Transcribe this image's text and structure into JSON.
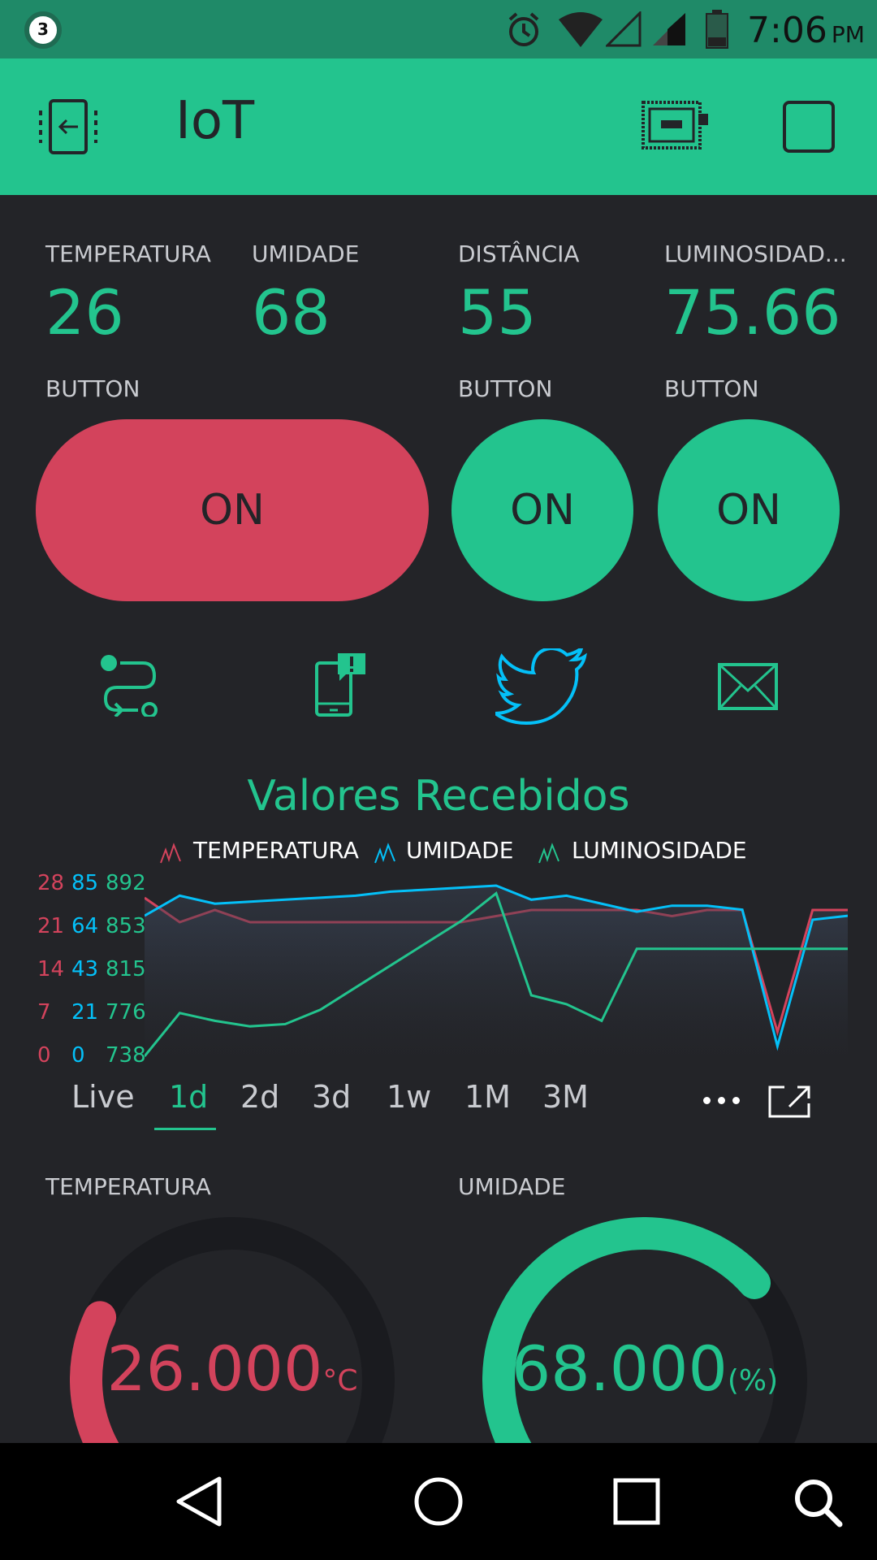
{
  "status": {
    "notification_count": "3",
    "time": "7:06",
    "ampm": "PM"
  },
  "app": {
    "title": "IoT"
  },
  "values": [
    {
      "label": "TEMPERATURA",
      "value": "26"
    },
    {
      "label": "UMIDADE",
      "value": "68"
    },
    {
      "label": "DISTÂNCIA",
      "value": "55"
    },
    {
      "label": "LUMINOSIDAD...",
      "value": "75.66"
    }
  ],
  "buttons": [
    {
      "label": "BUTTON",
      "state": "ON"
    },
    {
      "label": "BUTTON",
      "state": "ON"
    },
    {
      "label": "BUTTON",
      "state": "ON"
    }
  ],
  "colors": {
    "accent": "#23c48e",
    "red": "#d3435c",
    "blue": "#04c0f8",
    "bg": "#232428",
    "status": "#1f8a68"
  },
  "icons": [
    "eventor-icon",
    "notification-phone-icon",
    "twitter-icon",
    "mail-icon"
  ],
  "chart": {
    "title": "Valores Recebidos",
    "legend": [
      "TEMPERATURA",
      "UMIDADE",
      "LUMINOSIDADE"
    ],
    "axis_temp": [
      "28",
      "21",
      "14",
      "7",
      "0"
    ],
    "axis_umid": [
      "85",
      "64",
      "43",
      "21",
      "0"
    ],
    "axis_lum": [
      "892",
      "853",
      "815",
      "776",
      "738"
    ],
    "tabs": [
      "Live",
      "1d",
      "2d",
      "3d",
      "1w",
      "1M",
      "3M"
    ],
    "active_tab": "1d"
  },
  "chart_data": {
    "type": "line",
    "title": "Valores Recebidos",
    "series": [
      {
        "name": "TEMPERATURA",
        "color": "#d3435c",
        "axis_range": [
          0,
          28
        ],
        "values": [
          26,
          22,
          24,
          22,
          22,
          22,
          22,
          22,
          22,
          22,
          23,
          24,
          24,
          24,
          24,
          23,
          24,
          24,
          4,
          24,
          24
        ]
      },
      {
        "name": "UMIDADE",
        "color": "#04c0f8",
        "axis_range": [
          0,
          85
        ],
        "values": [
          70,
          80,
          76,
          77,
          78,
          79,
          80,
          82,
          83,
          84,
          85,
          78,
          80,
          76,
          72,
          75,
          75,
          73,
          5,
          68,
          70
        ]
      },
      {
        "name": "LUMINOSIDADE",
        "color": "#23c48e",
        "axis_range": [
          738,
          892
        ],
        "values": [
          738,
          777,
          770,
          765,
          767,
          780,
          800,
          820,
          840,
          860,
          885,
          793,
          785,
          770,
          835,
          835,
          835,
          835,
          835,
          835,
          835
        ]
      }
    ]
  },
  "gauges": [
    {
      "label": "TEMPERATURA",
      "value": "26.000",
      "unit": "°C",
      "fraction": 0.26,
      "color": "#d3435c"
    },
    {
      "label": "UMIDADE",
      "value": "68.000",
      "unit": "(%)",
      "fraction": 0.68,
      "color": "#23c48e"
    }
  ]
}
